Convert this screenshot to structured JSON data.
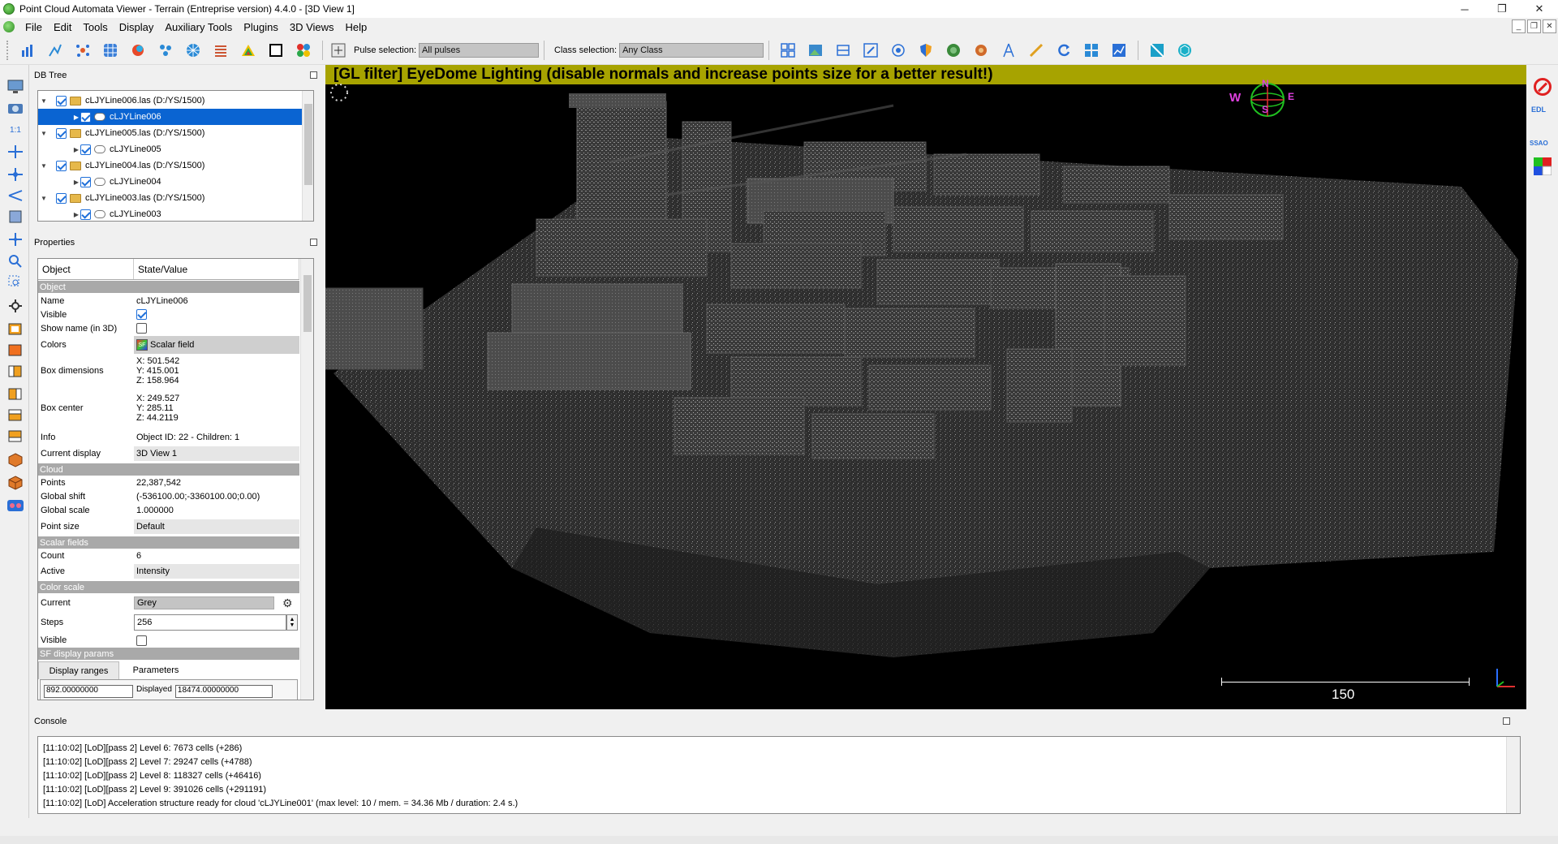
{
  "window": {
    "title": "Point Cloud Automata Viewer - Terrain (Entreprise version) 4.4.0 - [3D View 1]",
    "controls": [
      "─",
      "❐",
      "✕"
    ],
    "mdi_controls": [
      "_",
      "❐",
      "✕"
    ]
  },
  "menu": [
    "File",
    "Edit",
    "Tools",
    "Display",
    "Auxiliary Tools",
    "Plugins",
    "3D Views",
    "Help"
  ],
  "toolbar": {
    "pulse_label": "Pulse selection:",
    "pulse_value": "All pulses",
    "class_label": "Class selection:",
    "class_value": "Any Class"
  },
  "db_tree": {
    "title": "DB Tree",
    "items": [
      {
        "label": "cLJYLine006.las (D:/YS/1500)",
        "type": "file",
        "checked": true
      },
      {
        "label": "cLJYLine006",
        "type": "cloud",
        "checked": true,
        "selected": true
      },
      {
        "label": "cLJYLine005.las (D:/YS/1500)",
        "type": "file",
        "checked": true
      },
      {
        "label": "cLJYLine005",
        "type": "cloud",
        "checked": true
      },
      {
        "label": "cLJYLine004.las (D:/YS/1500)",
        "type": "file",
        "checked": true
      },
      {
        "label": "cLJYLine004",
        "type": "cloud",
        "checked": true
      },
      {
        "label": "cLJYLine003.las (D:/YS/1500)",
        "type": "file",
        "checked": true
      },
      {
        "label": "cLJYLine003",
        "type": "cloud",
        "checked": true
      }
    ]
  },
  "properties": {
    "title": "Properties",
    "col_object": "Object",
    "col_value": "State/Value",
    "sections": {
      "object": "Object",
      "cloud": "Cloud",
      "scalar_fields": "Scalar fields",
      "color_scale": "Color scale",
      "sf_display": "SF display params"
    },
    "name_k": "Name",
    "name_v": "cLJYLine006",
    "visible_k": "Visible",
    "showname_k": "Show name (in 3D)",
    "colors_k": "Colors",
    "colors_icon": "SF",
    "colors_v": "Scalar field",
    "boxdim_k": "Box dimensions",
    "boxdim_x": "X: 501.542",
    "boxdim_y": "Y: 415.001",
    "boxdim_z": "Z: 158.964",
    "boxcenter_k": "Box center",
    "boxcenter_x": "X: 249.527",
    "boxcenter_y": "Y: 285.11",
    "boxcenter_z": "Z: 44.2119",
    "info_k": "Info",
    "info_v": "Object ID: 22 - Children: 1",
    "display_k": "Current display",
    "display_v": "3D View 1",
    "points_k": "Points",
    "points_v": "22,387,542",
    "gshift_k": "Global shift",
    "gshift_v": "(-536100.00;-3360100.00;0.00)",
    "gscale_k": "Global scale",
    "gscale_v": "1.000000",
    "psize_k": "Point size",
    "psize_v": "Default",
    "count_k": "Count",
    "count_v": "6",
    "active_k": "Active",
    "active_v": "Intensity",
    "current_k": "Current",
    "current_v": "Grey",
    "steps_k": "Steps",
    "steps_v": "256",
    "csvisible_k": "Visible",
    "tab_ranges": "Display ranges",
    "tab_params": "Parameters",
    "range_min": "892.00000000",
    "displayed_label": "Displayed",
    "range_max": "18474.00000000"
  },
  "viewport": {
    "banner": "[GL filter] EyeDome Lighting (disable normals and increase points size for a better result!)",
    "scale_label": "150",
    "compass": {
      "w": "W",
      "n": "N",
      "e": "E",
      "s": "S"
    },
    "right_tools": [
      "EDL",
      "SSAO"
    ]
  },
  "console": {
    "title": "Console",
    "lines": [
      "[11:10:02] [LoD][pass 2] Level 6: 7673 cells (+286)",
      "[11:10:02] [LoD][pass 2] Level 7: 29247 cells (+4788)",
      "[11:10:02] [LoD][pass 2] Level 8: 118327 cells (+46416)",
      "[11:10:02] [LoD][pass 2] Level 9: 391026 cells (+291191)",
      "[11:10:02] [LoD] Acceleration structure ready for cloud 'cLJYLine001' (max level: 10 / mem. = 34.36 Mb / duration: 2.4 s.)"
    ]
  },
  "colors": {
    "accent": "#0a64d2",
    "banner": "#a7a300",
    "section": "#a9a9a9"
  }
}
